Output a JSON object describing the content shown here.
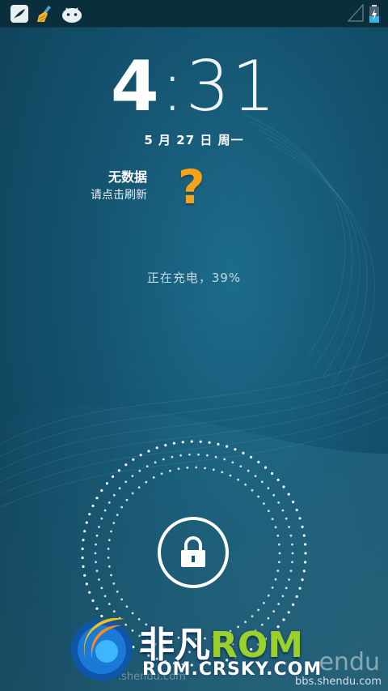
{
  "status_bar": {
    "left_icons": [
      "feather-app-icon",
      "broom-cleaner-icon",
      "android-icon"
    ],
    "right_icons": [
      "signal-empty-icon",
      "battery-charging-icon"
    ],
    "battery_level_pct": 39
  },
  "lockscreen": {
    "clock_hour": "4",
    "clock_sep": ":",
    "clock_minute": "31",
    "date": "5 月 27 日 周一",
    "weather": {
      "title": "无数据",
      "subtitle": "请点击刷新",
      "icon": "question-mark-icon"
    },
    "charging_status": "正在充电，39%",
    "unlock_icon": "lock-icon"
  },
  "watermark": {
    "brand_cn": "非凡",
    "brand_rom": "ROM",
    "url": "ROM.CRSKY.COM",
    "ghost_url": ".shendu.com",
    "corner_brand": "endu",
    "corner_url": "bbs.shendu.com"
  },
  "colors": {
    "background": "#14536f",
    "status_bar": "#0b2e3c",
    "question_mark": "#f3a31a",
    "rom_green": "#9bd12a"
  }
}
